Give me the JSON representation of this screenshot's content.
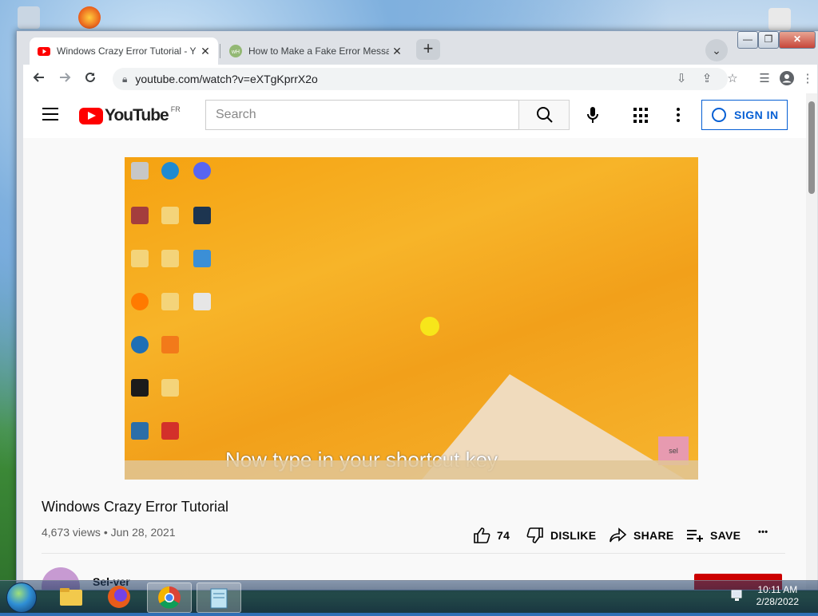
{
  "browser": {
    "tabs": [
      {
        "title": "Windows Crazy Error Tutorial - Y",
        "active": true
      },
      {
        "title": "How to Make a Fake Error Messa",
        "active": false
      }
    ],
    "new_tab": "+",
    "tab_close": "✕",
    "address": "youtube.com/watch?v=eXTgKprrX2o",
    "window_controls": {
      "minimize": "—",
      "restore": "❐",
      "close": "✕"
    }
  },
  "youtube": {
    "country_code": "FR",
    "logo_text": "YouTube",
    "search_placeholder": "Search",
    "sign_in": "SIGN IN",
    "video": {
      "caption": "Now type in your shortcut key",
      "watermark": "sel"
    },
    "title": "Windows Crazy Error Tutorial",
    "views": "4,673 views",
    "date": "Jun 28, 2021",
    "meta_sep": "•",
    "likes": "74",
    "dislike": "DISLIKE",
    "share": "SHARE",
    "save": "SAVE",
    "more": "•••",
    "channel_name": "Sel-ver"
  },
  "taskbar": {
    "time": "10:11 AM",
    "date": "2/28/2022"
  },
  "colors": {
    "youtube_red": "#FF0000",
    "link_blue": "#065FD4",
    "video_orange": "#F5A211"
  }
}
